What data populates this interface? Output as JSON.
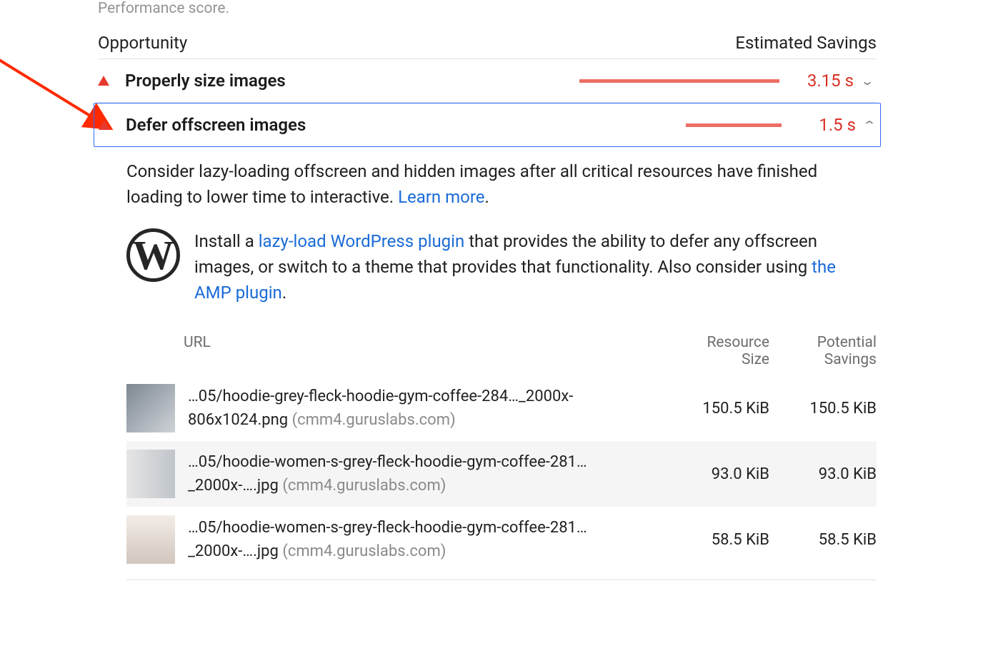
{
  "header": {
    "subtitle": "Performance score.",
    "col_opportunity": "Opportunity",
    "col_savings": "Estimated Savings"
  },
  "opportunities": [
    {
      "title": "Properly size images",
      "savings": "3.15 s",
      "expanded": false,
      "bar_pct": 100
    },
    {
      "title": "Defer offscreen images",
      "savings": "1.5 s",
      "expanded": true,
      "bar_pct": 48
    }
  ],
  "detail": {
    "desc_pre": "Consider lazy-loading offscreen and hidden images after all critical resources have finished loading to lower time to interactive. ",
    "learn_more": "Learn more",
    "period": ".",
    "wp_text_1": "Install a ",
    "wp_link_1": "lazy-load WordPress plugin",
    "wp_text_2": " that provides the ability to defer any offscreen images, or switch to a theme that provides that functionality. Also consider using ",
    "wp_link_2": "the AMP plugin",
    "wp_text_3": "."
  },
  "table": {
    "headers": {
      "url": "URL",
      "resource_size_l1": "Resource",
      "resource_size_l2": "Size",
      "potential_l1": "Potential",
      "potential_l2": "Savings"
    },
    "rows": [
      {
        "url": "…05/hoodie-grey-fleck-hoodie-gym-coffee-284…_2000x-806x1024.png",
        "host": "(cmm4.guruslabs.com)",
        "resource_size": "150.5 KiB",
        "potential_savings": "150.5 KiB"
      },
      {
        "url": "…05/hoodie-women-s-grey-fleck-hoodie-gym-coffee-281…_2000x-….jpg",
        "host": "(cmm4.guruslabs.com)",
        "resource_size": "93.0 KiB",
        "potential_savings": "93.0 KiB"
      },
      {
        "url": "…05/hoodie-women-s-grey-fleck-hoodie-gym-coffee-281…_2000x-….jpg",
        "host": "(cmm4.guruslabs.com)",
        "resource_size": "58.5 KiB",
        "potential_savings": "58.5 KiB"
      }
    ]
  }
}
